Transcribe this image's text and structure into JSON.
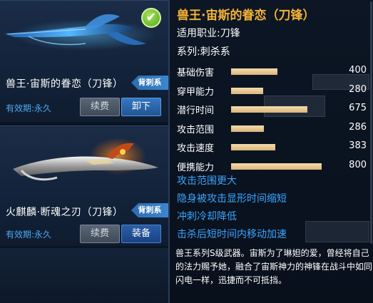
{
  "weapons": [
    {
      "name": "兽王·宙斯的眷恋（刀锋）",
      "class_tag": "背刺系",
      "expiry": "有效期:永久",
      "renew_label": "续费",
      "action_label": "卸下",
      "equipped_check": "✔"
    },
    {
      "name": "火麒麟·断魂之刃（刀锋）",
      "class_tag": "背刺系",
      "expiry": "有效期:永久",
      "renew_label": "续费",
      "action_label": "装备"
    }
  ],
  "detail": {
    "title": "兽王·宙斯的眷恋（刀锋）",
    "job": "适用职业:刀锋",
    "series": "系列:刺杀系",
    "stats": [
      {
        "label": "基础伤害",
        "value": 400,
        "fill": 0.38
      },
      {
        "label": "穿甲能力",
        "value": 280,
        "fill": 0.26
      },
      {
        "label": "潜行时间",
        "value": 675,
        "fill": 0.62
      },
      {
        "label": "攻击范围",
        "value": 286,
        "fill": 0.27
      },
      {
        "label": "攻击速度",
        "value": 383,
        "fill": 0.36
      },
      {
        "label": "便携能力",
        "value": 800,
        "fill": 0.74
      }
    ],
    "perks": [
      "攻击范围更大",
      "隐身被攻击显形时间缩短",
      "冲刺冷却降低",
      "击杀后短时间内移动加速"
    ],
    "description": "兽王系列S级武器。宙斯为了琳妲的爱，曾经将自己的法力赐予她，融合了宙斯神力的神锋在战斗中如同闪电一样，迅捷而不可抵挡。"
  },
  "colors": {
    "title": "#f2b236",
    "perk": "#3aa6ff",
    "stat_bar": "#e6c68e",
    "tag": "#3478c0",
    "expiry": "#4fa8f0"
  }
}
